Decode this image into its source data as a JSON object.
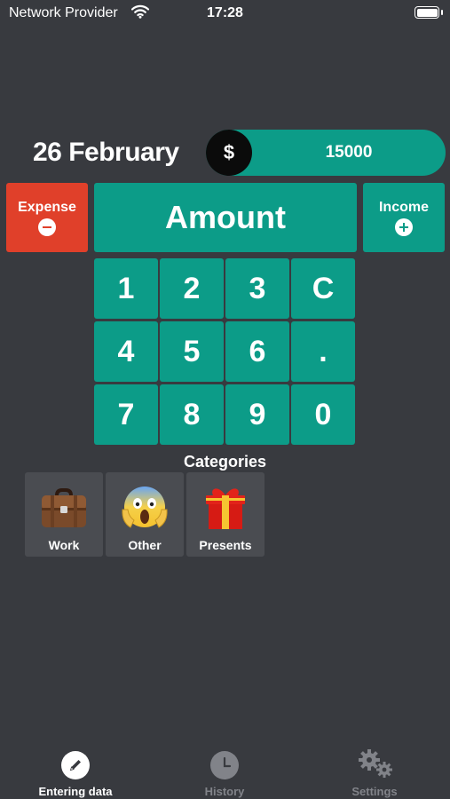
{
  "status_bar": {
    "carrier": "Network Provider",
    "time": "17:28"
  },
  "header": {
    "date": "26 February",
    "currency_symbol": "$",
    "balance": "15000"
  },
  "entry": {
    "expense_label": "Expense",
    "amount_label": "Amount",
    "income_label": "Income"
  },
  "keypad": {
    "keys": [
      "1",
      "2",
      "3",
      "C",
      "4",
      "5",
      "6",
      ".",
      "7",
      "8",
      "9",
      "0"
    ]
  },
  "categories": {
    "title": "Categories",
    "items": [
      {
        "label": "Work",
        "icon": "briefcase-icon"
      },
      {
        "label": "Other",
        "icon": "screaming-face-icon"
      },
      {
        "label": "Presents",
        "icon": "gift-icon"
      }
    ]
  },
  "tabbar": {
    "tabs": [
      {
        "label": "Entering data",
        "icon": "pencil-icon",
        "active": true
      },
      {
        "label": "History",
        "icon": "clock-icon",
        "active": false
      },
      {
        "label": "Settings",
        "icon": "gears-icon",
        "active": false
      }
    ]
  },
  "colors": {
    "background": "#383a3f",
    "accent": "#0c9c88",
    "expense": "#e0402a",
    "tile": "#4a4c51",
    "inactive": "#818389"
  }
}
